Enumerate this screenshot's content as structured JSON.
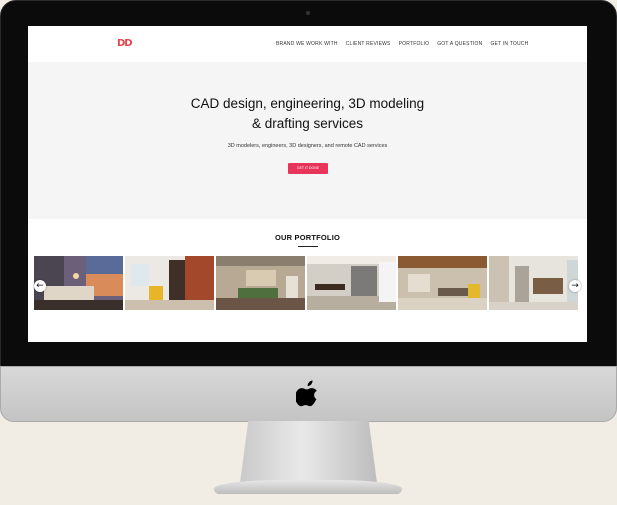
{
  "site": {
    "logo_text": "DD",
    "nav": [
      {
        "label": "BRAND WE WORK WITH"
      },
      {
        "label": "CLIENT REVIEWS"
      },
      {
        "label": "PORTFOLIO"
      },
      {
        "label": "GOT A QUESTION"
      },
      {
        "label": "GET IN TOUCH"
      }
    ]
  },
  "hero": {
    "title_line1": "CAD design, engineering, 3D modeling",
    "title_line2": "& drafting services",
    "subtitle": "3D modelers, engineers, 3D designers, and remote CAD services",
    "cta_label": "GET IT DONE"
  },
  "portfolio": {
    "title": "OUR PORTFOLIO",
    "thumbnails": [
      {
        "name": "bedroom-render"
      },
      {
        "name": "living-room-yellow-chair"
      },
      {
        "name": "living-room-green-sofa"
      },
      {
        "name": "dining-kitchen"
      },
      {
        "name": "living-room-wood-ceiling"
      },
      {
        "name": "kitchen-open-plan"
      }
    ],
    "prev_icon": "arrow-left-icon",
    "next_icon": "arrow-right-icon"
  },
  "colors": {
    "accent": "#e8345b",
    "logo": "#e24550",
    "bezel": "#0b0b0c",
    "page_bg": "#f1ece4"
  }
}
